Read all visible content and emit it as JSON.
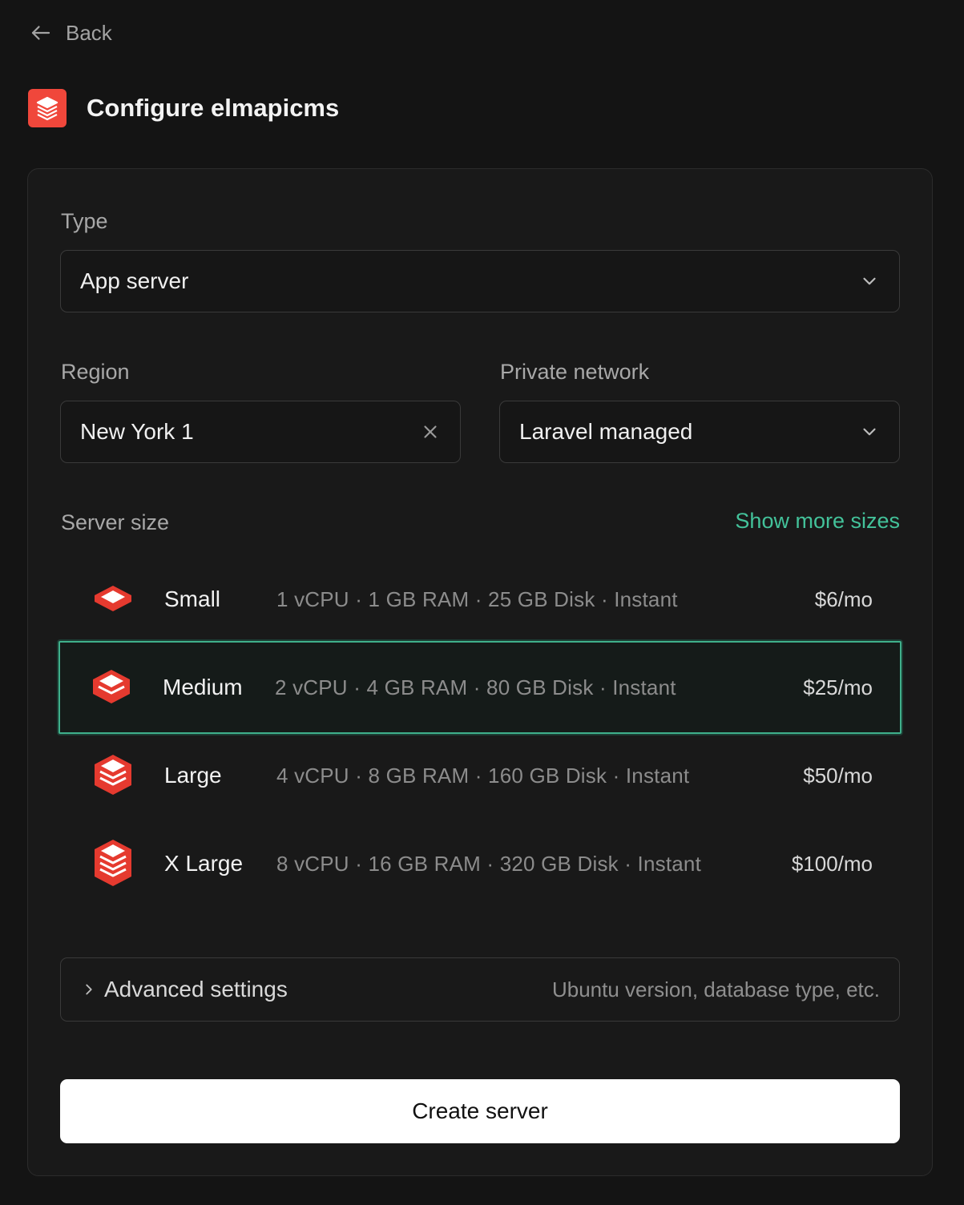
{
  "nav": {
    "back_label": "Back"
  },
  "header": {
    "title": "Configure elmapicms"
  },
  "form": {
    "type": {
      "label": "Type",
      "value": "App server"
    },
    "region": {
      "label": "Region",
      "value": "New York 1"
    },
    "private_network": {
      "label": "Private network",
      "value": "Laravel managed"
    },
    "server_size": {
      "label": "Server size",
      "show_more_label": "Show more sizes",
      "options": [
        {
          "name": "Small",
          "spec": "1 vCPU  ·  1 GB RAM  ·  25 GB Disk · Instant",
          "price": "$6/mo",
          "selected": false
        },
        {
          "name": "Medium",
          "spec": "2 vCPU  ·  4 GB RAM  ·  80 GB Disk · Instant",
          "price": "$25/mo",
          "selected": true
        },
        {
          "name": "Large",
          "spec": "4 vCPU  ·  8 GB RAM  ·  160 GB Disk · Instant",
          "price": "$50/mo",
          "selected": false
        },
        {
          "name": "X Large",
          "spec": "8 vCPU  ·  16 GB RAM  ·  320 GB Disk · Instant",
          "price": "$100/mo",
          "selected": false
        }
      ]
    },
    "advanced": {
      "title": "Advanced settings",
      "hint": "Ubuntu version, database type, etc."
    },
    "submit_label": "Create server"
  },
  "colors": {
    "background": "#141414",
    "card": "#191919",
    "brand_red": "#f0473b",
    "accent_green": "#43c29a",
    "selected_border": "#3fb08b"
  },
  "icons": {
    "back": "arrow-left-icon",
    "logo": "forge-stack-logo",
    "dropdown": "chevron-down-icon",
    "clear": "close-icon",
    "server": "server-stack-icon",
    "expand": "chevron-right-icon"
  }
}
